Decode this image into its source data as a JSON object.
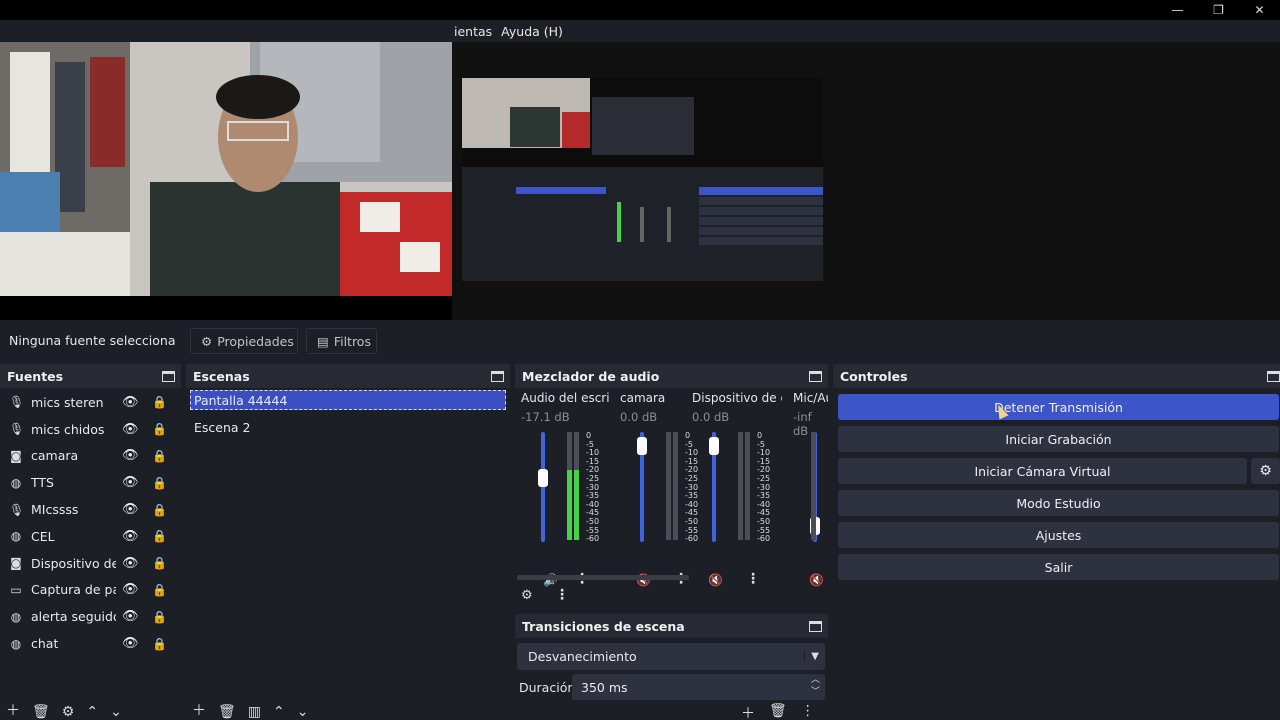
{
  "menu": {
    "items": [
      "ientas",
      "Ayuda (H)"
    ]
  },
  "window_controls": {
    "minimize": "—",
    "maximize": "❐",
    "close": "✕"
  },
  "context": {
    "no_source": "Ninguna fuente selecciona",
    "properties": "Propiedades",
    "filters": "Filtros"
  },
  "sources": {
    "title": "Fuentes",
    "items": [
      {
        "name": "mics steren",
        "icon": "microphone-icon"
      },
      {
        "name": "mics chidos",
        "icon": "microphone-icon"
      },
      {
        "name": "camara",
        "icon": "camera-icon"
      },
      {
        "name": "TTS",
        "icon": "browser-icon"
      },
      {
        "name": "MIcssss",
        "icon": "microphone-icon"
      },
      {
        "name": "CEL",
        "icon": "browser-icon"
      },
      {
        "name": "Dispositivo de c",
        "icon": "camera-icon"
      },
      {
        "name": "Captura de pant",
        "icon": "monitor-icon"
      },
      {
        "name": "alerta seguidor",
        "icon": "browser-icon"
      },
      {
        "name": "chat",
        "icon": "browser-icon"
      }
    ]
  },
  "scenes": {
    "title": "Escenas",
    "items": [
      "Pantalla 44444",
      "Escena 2"
    ],
    "active": 0
  },
  "mixer": {
    "title": "Mezclador de audio",
    "channels": [
      {
        "name": "Audio del escrito",
        "db": "-17.1 dB",
        "fader": 0.6,
        "muted": false,
        "level": 0.65
      },
      {
        "name": "camara",
        "db": "0.0 dB",
        "fader": 0.95,
        "muted": true,
        "level": 0.0
      },
      {
        "name": "Dispositivo de ca",
        "db": "0.0 dB",
        "fader": 0.95,
        "muted": true,
        "level": 0.0
      },
      {
        "name": "Mic/Au",
        "db": "-inf dB",
        "fader": 0.08,
        "muted": true,
        "level": 0.0
      }
    ],
    "ticks": [
      "0",
      "-5",
      "-10",
      "-15",
      "-20",
      "-25",
      "-30",
      "-35",
      "-40",
      "-45",
      "-50",
      "-55",
      "-60"
    ]
  },
  "transitions": {
    "title": "Transiciones de escena",
    "selected": "Desvanecimiento",
    "duration_label": "Duración",
    "duration_value": "350 ms"
  },
  "controls": {
    "title": "Controles",
    "buttons": [
      {
        "label": "Detener Transmisión",
        "active": true
      },
      {
        "label": "Iniciar Grabación",
        "active": false
      },
      {
        "label": "Iniciar Cámara Virtual",
        "active": false
      },
      {
        "label": "Modo Estudio",
        "active": false
      },
      {
        "label": "Ajustes",
        "active": false
      },
      {
        "label": "Salir",
        "active": false
      }
    ]
  },
  "colors": {
    "accent": "#3c55c9",
    "panel": "#272a33",
    "bg": "#1d1f26",
    "meter_green": "#45d14a",
    "mute_red": "#d33"
  }
}
